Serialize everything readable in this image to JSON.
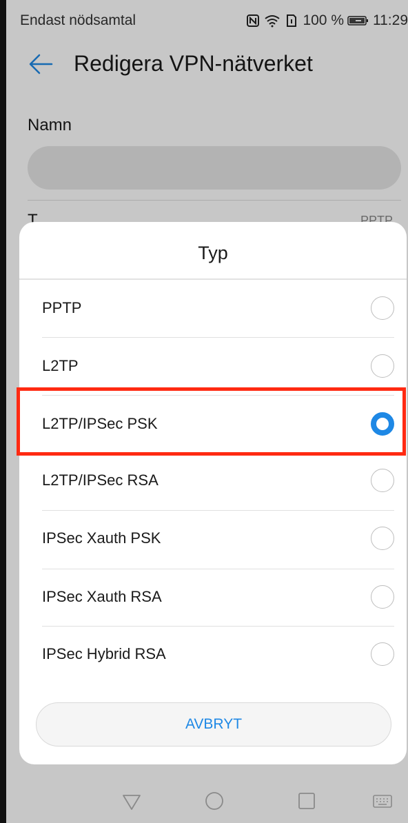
{
  "status_bar": {
    "carrier_text": "Endast nödsamtal",
    "battery_percent": "100 %",
    "time": "11:29",
    "icons": [
      "nfc-icon",
      "wifi-icon",
      "sim-icon",
      "battery-icon"
    ]
  },
  "app_bar": {
    "title": "Redigera VPN-nätverket",
    "back_icon": "arrow-left-icon",
    "back_color": "#1e88e5"
  },
  "form": {
    "name_label": "Namn",
    "name_value": "",
    "type_label": "T",
    "type_value": "PPTP"
  },
  "dialog": {
    "title": "Typ",
    "options": [
      {
        "label": "PPTP",
        "selected": false
      },
      {
        "label": "L2TP",
        "selected": false
      },
      {
        "label": "L2TP/IPSec PSK",
        "selected": true
      },
      {
        "label": "L2TP/IPSec RSA",
        "selected": false
      },
      {
        "label": "IPSec Xauth PSK",
        "selected": false
      },
      {
        "label": "IPSec Xauth RSA",
        "selected": false
      },
      {
        "label": "IPSec Hybrid RSA",
        "selected": false
      }
    ],
    "cancel_label": "AVBRYT",
    "accent_color": "#1e88e5"
  },
  "annotation": {
    "highlight_color": "#ff2a12",
    "highlighted_option": "L2TP/IPSec PSK"
  },
  "nav_bar": {
    "icons": [
      "back-triangle-icon",
      "home-circle-icon",
      "recents-square-icon",
      "keyboard-icon"
    ]
  }
}
